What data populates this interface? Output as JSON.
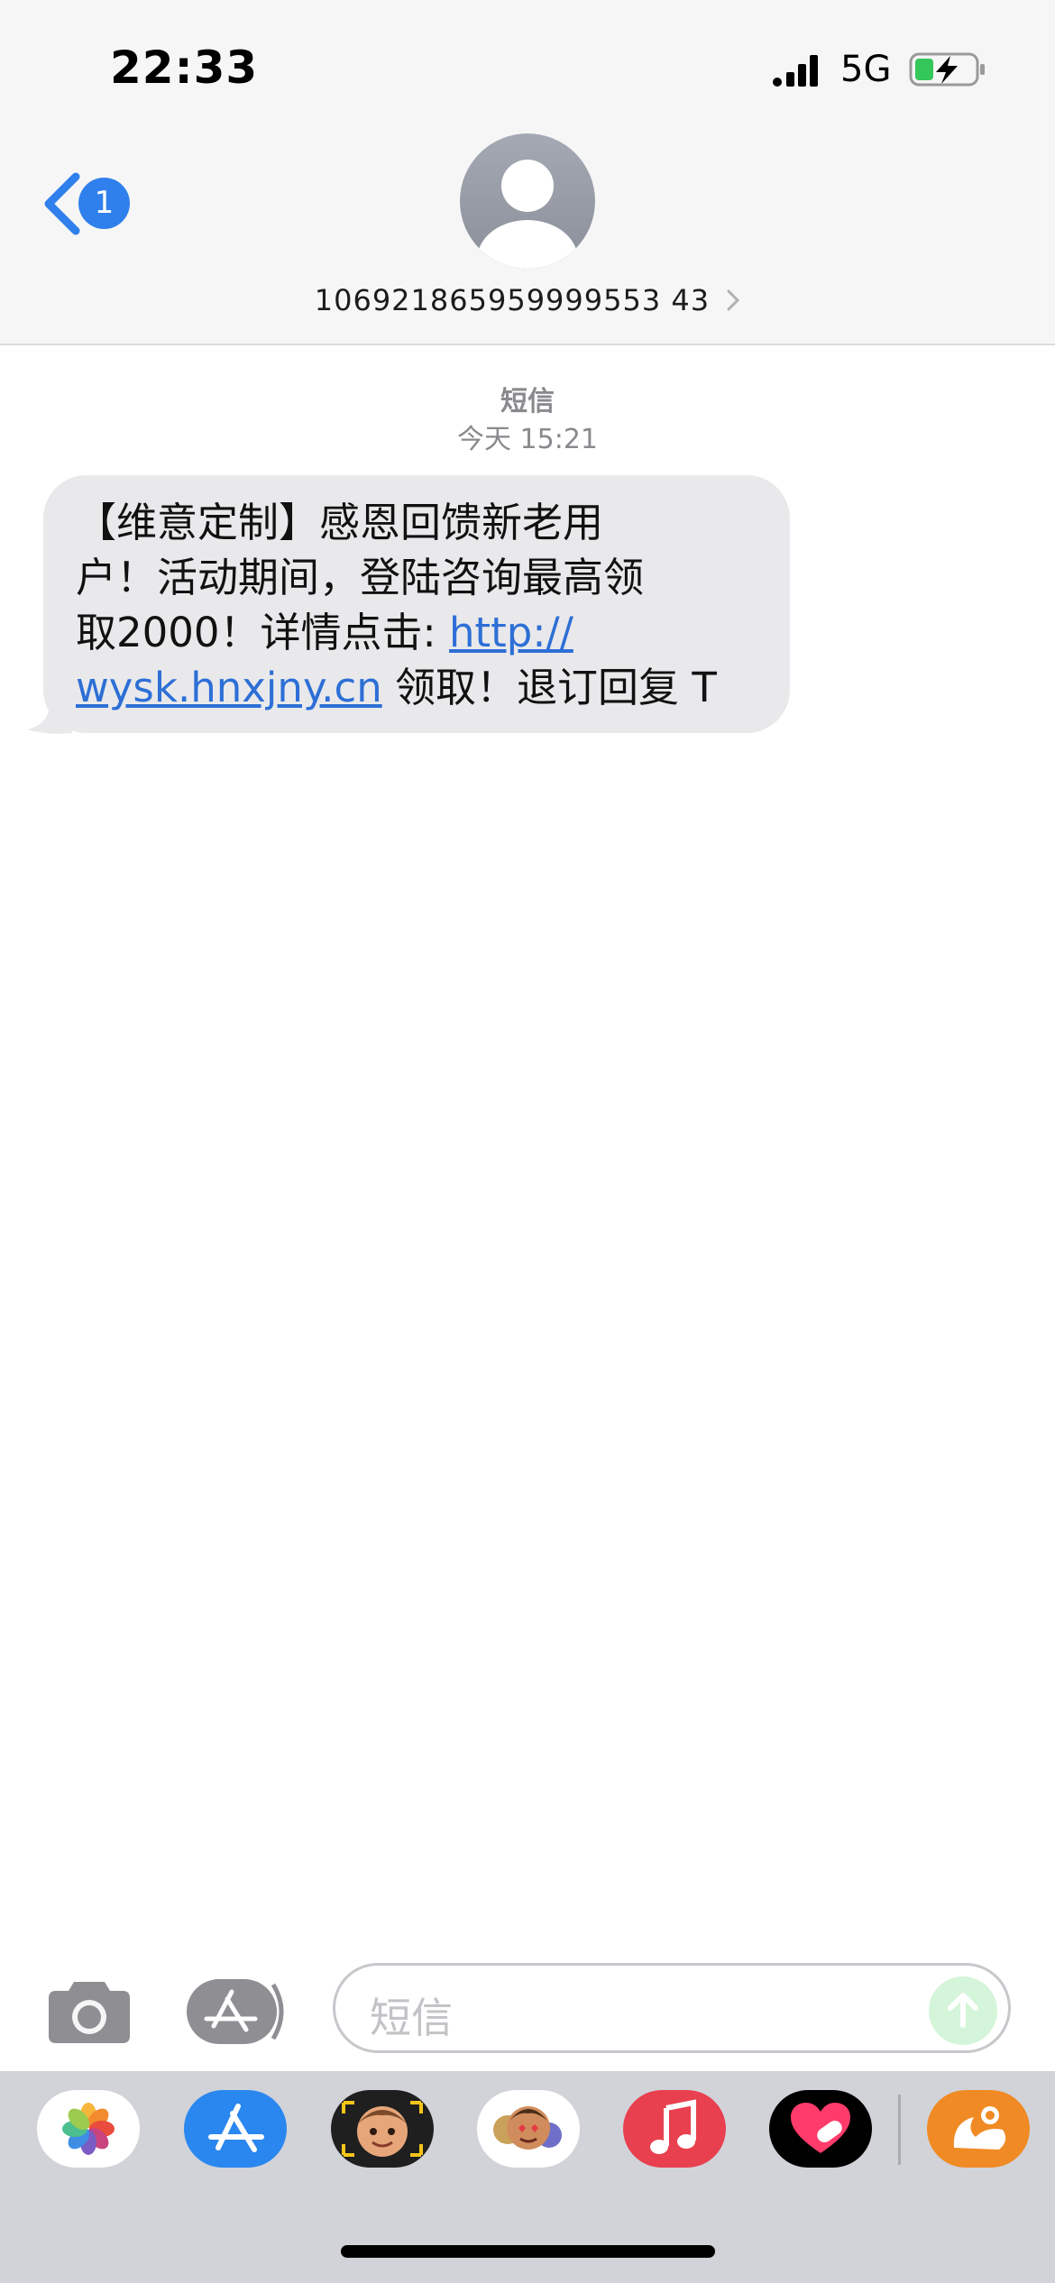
{
  "status_bar": {
    "time": "22:33",
    "network": "5G",
    "icons": [
      "signal-bars-icon",
      "battery-charging-icon"
    ]
  },
  "header": {
    "back_count": "1",
    "contact_number": "106921865959999553 43"
  },
  "conversation": {
    "service_label": "短信",
    "timestamp": "今天 15:21",
    "message": {
      "lines": [
        "【维意定制】感恩回馈新老用",
        "户！活动期间，登陆咨询最高领",
        "取2000！详情点击: "
      ],
      "link_part1": "http://",
      "link_part2": "wysk.hnxjny.cn",
      "after_link": " 领取！退订回复 T"
    }
  },
  "input_bar": {
    "placeholder": "短信"
  },
  "app_drawer": {
    "apps": [
      "photos-icon",
      "app-store-icon",
      "memoji-stickers-icon",
      "animoji-icon",
      "music-icon",
      "digital-touch-icon",
      "uc-browser-icon"
    ]
  },
  "colors": {
    "link": "#2d6fd6",
    "badge": "#2f80ed",
    "bubble": "#e9e9eb",
    "send_button": "#d4f5d9"
  }
}
